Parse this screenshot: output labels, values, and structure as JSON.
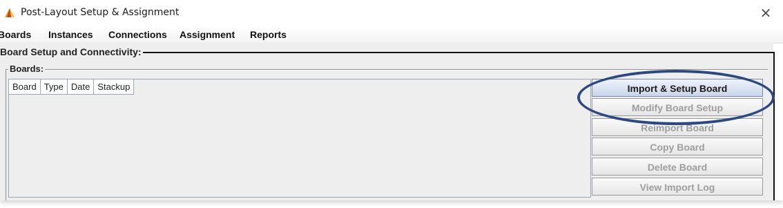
{
  "window": {
    "title": "Post-Layout Setup & Assignment",
    "close_label": "✕"
  },
  "menubar": {
    "items": [
      "Boards",
      "Instances",
      "Connections",
      "Assignment",
      "Reports"
    ]
  },
  "panel": {
    "title": "Board Setup and Connectivity:",
    "boards_group_title": "Boards:"
  },
  "table": {
    "columns": [
      "Board",
      "Type",
      "Date",
      "Stackup"
    ],
    "rows": []
  },
  "buttons": {
    "import_setup": "Import & Setup Board",
    "modify_setup": "Modify Board Setup",
    "reimport": "Reimport Board",
    "copy": "Copy Board",
    "delete": "Delete Board",
    "view_log": "View Import Log"
  },
  "colors": {
    "highlight_ring": "#2c4880",
    "panel_bg": "#eeeeee",
    "disabled_text": "#9e9e9e"
  }
}
